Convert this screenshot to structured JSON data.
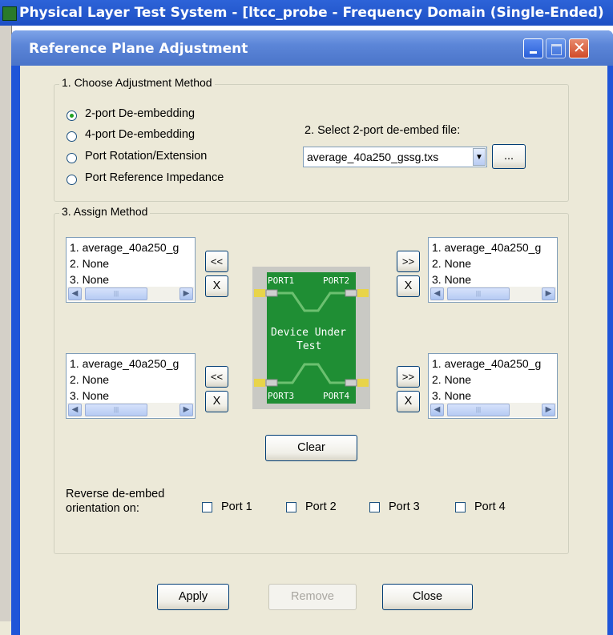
{
  "app": {
    "title": "Physical Layer Test System - [ltcc_probe - Frequency Domain (Single-Ended)"
  },
  "dialog": {
    "title": "Reference Plane Adjustment",
    "group1": {
      "label": "1. Choose Adjustment Method",
      "options": [
        {
          "label": "2-port De-embedding",
          "selected": true
        },
        {
          "label": "4-port De-embedding",
          "selected": false
        },
        {
          "label": "Port Rotation/Extension",
          "selected": false
        },
        {
          "label": "Port Reference Impedance",
          "selected": false
        }
      ],
      "select_file_label": "2. Select 2-port de-embed file:",
      "file_value": "average_40a250_gssg.txs",
      "browse_label": "..."
    },
    "group3": {
      "label": "3. Assign Method",
      "lists": {
        "port1": [
          "1. average_40a250_g",
          "2. None",
          "3. None"
        ],
        "port2": [
          "1. average_40a250_g",
          "2. None",
          "3. None"
        ],
        "port3": [
          "1. average_40a250_g",
          "2. None",
          "3. None"
        ],
        "port4": [
          "1. average_40a250_g",
          "2. None",
          "3. None"
        ]
      },
      "assign_left": "<<",
      "assign_right": ">>",
      "remove_x": "X",
      "dut": {
        "port1": "PORT1",
        "port2": "PORT2",
        "port3": "PORT3",
        "port4": "PORT4",
        "line1": "Device Under",
        "line2": "Test"
      },
      "clear_label": "Clear",
      "reverse_label_1": "Reverse de-embed",
      "reverse_label_2": "orientation on:",
      "ports": [
        {
          "label": "Port 1",
          "checked": false
        },
        {
          "label": "Port 2",
          "checked": false
        },
        {
          "label": "Port 3",
          "checked": false
        },
        {
          "label": "Port 4",
          "checked": false
        }
      ]
    },
    "buttons": {
      "apply": "Apply",
      "remove": "Remove",
      "close": "Close"
    }
  }
}
